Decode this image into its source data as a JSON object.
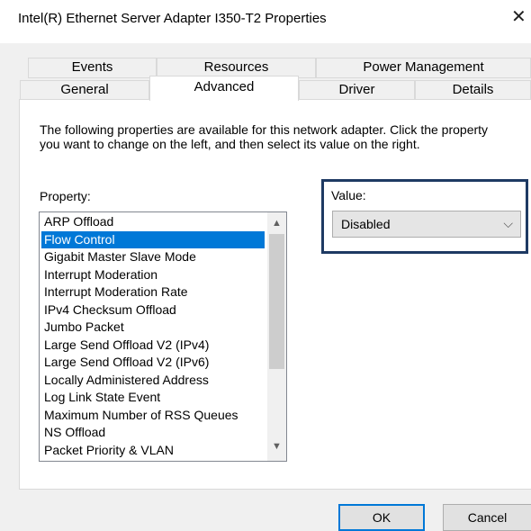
{
  "window": {
    "title": "Intel(R) Ethernet Server Adapter I350-T2 Properties",
    "close_glyph": "✕"
  },
  "tabs": {
    "row1": [
      "Events",
      "Resources",
      "Power Management"
    ],
    "row2": [
      "General",
      "Advanced",
      "Driver",
      "Details"
    ],
    "active": "Advanced"
  },
  "description": "The following properties are available for this network adapter. Click the property you want to change on the left, and then select its value on the right.",
  "property": {
    "label": "Property:",
    "items": [
      "ARP Offload",
      "Flow Control",
      "Gigabit Master Slave Mode",
      "Interrupt Moderation",
      "Interrupt Moderation Rate",
      "IPv4 Checksum Offload",
      "Jumbo Packet",
      "Large Send Offload V2 (IPv4)",
      "Large Send Offload V2 (IPv6)",
      "Locally Administered Address",
      "Log Link State Event",
      "Maximum Number of RSS Queues",
      "NS Offload",
      "Packet Priority & VLAN"
    ],
    "selected": "Flow Control"
  },
  "value": {
    "label": "Value:",
    "selected": "Disabled"
  },
  "buttons": {
    "ok": "OK",
    "cancel": "Cancel"
  },
  "icons": {
    "close": "close-icon",
    "scroll_up": "chevron-up-icon",
    "scroll_down": "chevron-down-icon",
    "dropdown": "chevron-down-icon"
  },
  "colors": {
    "selection": "#0078d7",
    "value_highlight": "#1e3a63"
  }
}
